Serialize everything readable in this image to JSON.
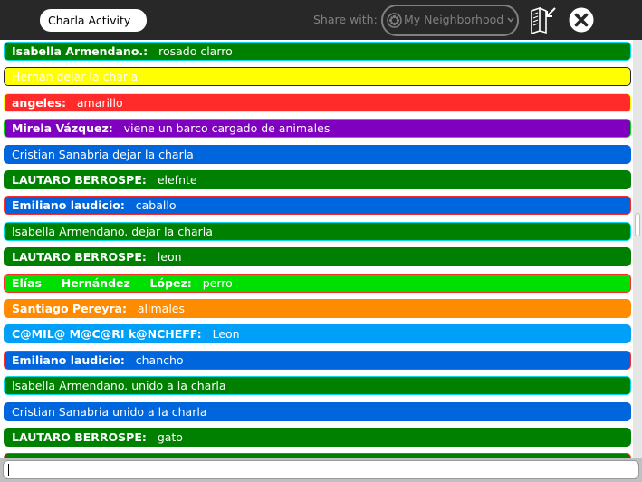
{
  "toolbar": {
    "activity_title": "Charla Activity",
    "share_label": "Share with:",
    "share_value": "My Neighborhood",
    "share_icon": "neighborhood-icon",
    "keep_icon": "journal-keep-icon",
    "stop_icon": "stop-icon"
  },
  "colors": {
    "toolbar": "#282828",
    "dark_green": "#008000",
    "yellow": "#ffff00",
    "red": "#ff2b2b",
    "purple": "#7f00bf",
    "blue": "#0066dd",
    "bright_green": "#00e000",
    "orange": "#ff8c00",
    "light_blue": "#00a0f8"
  },
  "messages": [
    {
      "nick": "Isabella Armendano.:",
      "text": "rosado clarro",
      "fill": "#008000",
      "stroke": "#00ddee",
      "fg": "#ffffff"
    },
    {
      "nick": "",
      "text": "Hernan dejar la charla",
      "fill": "#ffff00",
      "stroke": "#282828",
      "fg": "#ffffff"
    },
    {
      "nick": "angeles:",
      "text": "amarillo",
      "fill": "#ff2b2b",
      "stroke": "#ffff00",
      "fg": "#ffffff"
    },
    {
      "nick": "Mirela Vázquez:",
      "text": "viene un barco cargado de animales",
      "fill": "#7f00bf",
      "stroke": "#00e000",
      "fg": "#ffffff"
    },
    {
      "nick": "",
      "text": "Cristian Sanabria dejar la charla",
      "fill": "#0066dd",
      "stroke": "#0066dd",
      "fg": "#ffffff"
    },
    {
      "nick": "LAUTARO BERROSPE:",
      "text": "elefnte",
      "fill": "#008000",
      "stroke": "#008000",
      "fg": "#ffffff"
    },
    {
      "nick": "Emiliano laudicio:",
      "text": "caballo",
      "fill": "#0066dd",
      "stroke": "#ff2b2b",
      "fg": "#ffffff"
    },
    {
      "nick": "",
      "text": "Isabella Armendano. dejar la charla",
      "fill": "#008000",
      "stroke": "#00ddee",
      "fg": "#ffffff"
    },
    {
      "nick": "LAUTARO BERROSPE:",
      "text": "leon",
      "fill": "#008000",
      "stroke": "#008000",
      "fg": "#ffffff"
    },
    {
      "nick": "Elías     Hernández     López:",
      "text": "perro",
      "fill": "#00e000",
      "stroke": "#ff2b2b",
      "fg": "#ffffff"
    },
    {
      "nick": "Santiago Pereyra:",
      "text": "alimales",
      "fill": "#ff8c00",
      "stroke": "#ff8c00",
      "fg": "#ffffff"
    },
    {
      "nick": "C@MIL@ M@C@RI k@NCHEFF:",
      "text": "Leon",
      "fill": "#00a0f8",
      "stroke": "#00a0f8",
      "fg": "#ffffff"
    },
    {
      "nick": "Emiliano laudicio:",
      "text": "chancho",
      "fill": "#0066dd",
      "stroke": "#ff2b2b",
      "fg": "#ffffff"
    },
    {
      "nick": "",
      "text": "Isabella Armendano. unido a la charla",
      "fill": "#008000",
      "stroke": "#00ddee",
      "fg": "#ffffff"
    },
    {
      "nick": "",
      "text": "Cristian Sanabria unido a la charla",
      "fill": "#0066dd",
      "stroke": "#0066dd",
      "fg": "#ffffff"
    },
    {
      "nick": "LAUTARO BERROSPE:",
      "text": "gato",
      "fill": "#008000",
      "stroke": "#008000",
      "fg": "#ffffff"
    },
    {
      "nick": "",
      "text": "",
      "fill": "#008000",
      "stroke": "#ff2b2b",
      "fg": "#ffffff"
    }
  ],
  "entry": {
    "value": ""
  }
}
